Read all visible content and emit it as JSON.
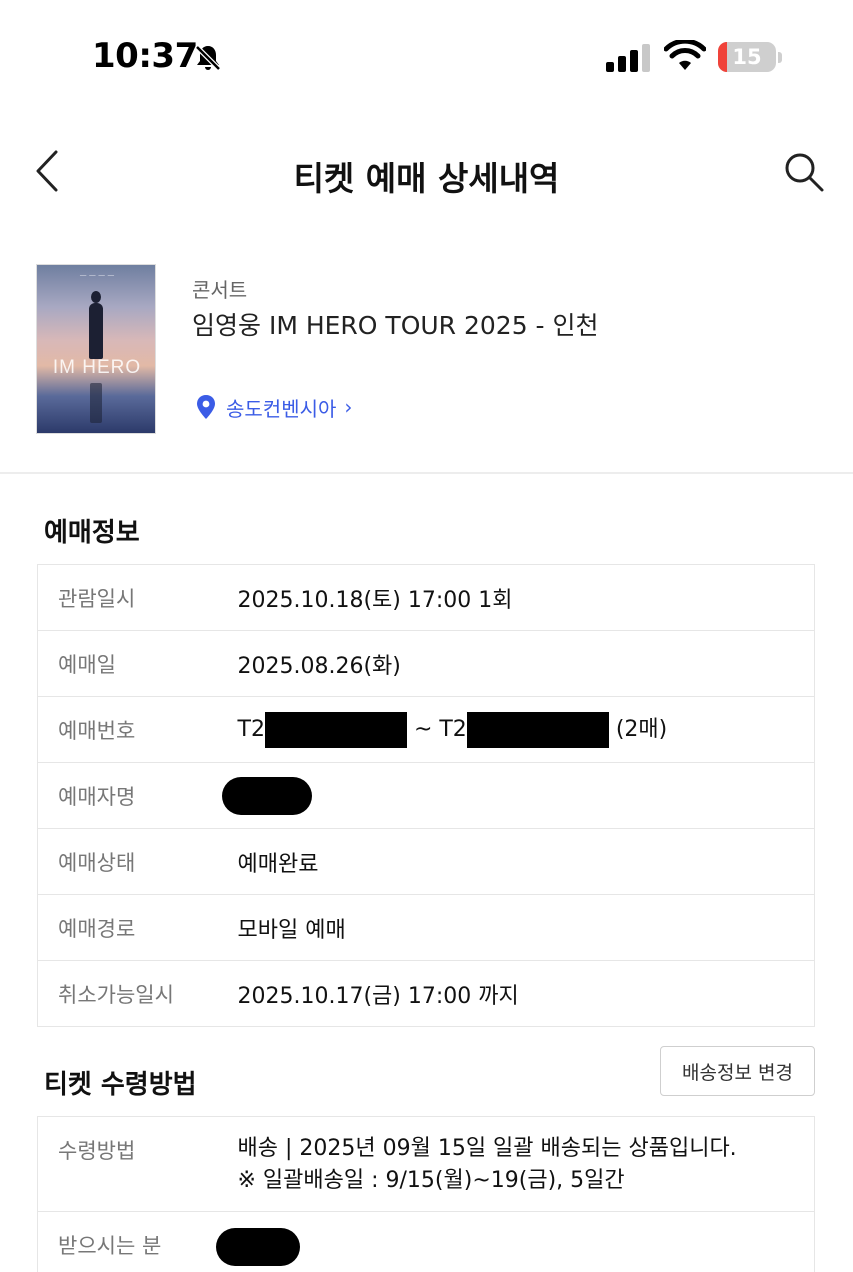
{
  "status_bar": {
    "time": "10:37",
    "battery_percent": "15",
    "battery_level": 0.15
  },
  "header": {
    "title": "티켓 예매 상세내역"
  },
  "event": {
    "category": "콘서트",
    "name": "임영웅 IM HERO TOUR 2025 - 인천",
    "venue": "송도컨벤시아",
    "venue_chevron": "›",
    "poster_logo": "IM HERO"
  },
  "booking_info": {
    "title": "예매정보",
    "rows": [
      {
        "label": "관람일시",
        "value": "2025.10.18(토) 17:00 1회"
      },
      {
        "label": "예매일",
        "value": "2025.08.26(화)"
      },
      {
        "label": "예매번호",
        "prefix": "T2",
        "separator": "~ T2",
        "suffix": "(2매)"
      },
      {
        "label": "예매자명",
        "value": ""
      },
      {
        "label": "예매상태",
        "value": "예매완료"
      },
      {
        "label": "예매경로",
        "value": "모바일 예매"
      },
      {
        "label": "취소가능일시",
        "value": "2025.10.17(금) 17:00 까지"
      }
    ]
  },
  "ticket_receipt": {
    "title": "티켓 수령방법",
    "change_button": "배송정보 변경",
    "rows": [
      {
        "label": "수령방법",
        "line1": "배송 | 2025년 09월 15일 일괄 배송되는 상품입니다.",
        "line2": "※ 일괄배송일 : 9/15(월)~19(금), 5일간"
      },
      {
        "label": "받으시는 분",
        "value": ""
      }
    ]
  },
  "colors": {
    "link": "#3b5ce6",
    "battery_low": "#f0433a",
    "border": "#e6e6e6"
  }
}
